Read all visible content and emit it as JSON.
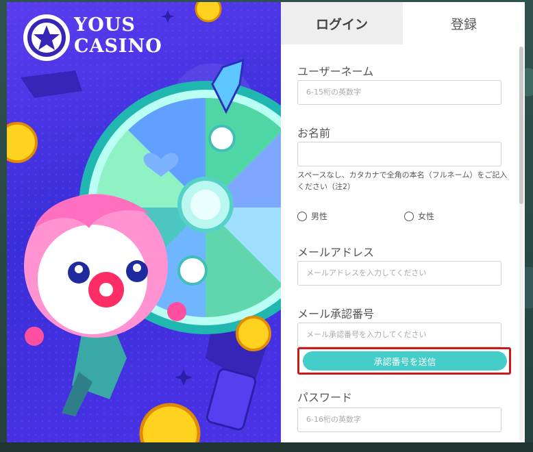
{
  "brand": {
    "logo_line1": "YOUS",
    "logo_line2": "CASINO"
  },
  "tabs": {
    "login": "ログイン",
    "register": "登録"
  },
  "form": {
    "username_label": "ユーザーネーム",
    "username_placeholder": "6-15桁の英数字",
    "name_label": "お名前",
    "name_value": "",
    "name_note": "スペースなし、カタカナで全角の本名（フルネーム）をご記入ください（注2）",
    "gender_male": "男性",
    "gender_female": "女性",
    "email_label": "メールアドレス",
    "email_placeholder": "メールアドレスを入力してください",
    "code_label": "メール承認番号",
    "code_placeholder": "メール承認番号を入力してください",
    "send_button": "承認番号を送信",
    "password_label": "パスワード",
    "password_placeholder": "6-16桁の英数字"
  },
  "colors": {
    "accent": "#45cec9",
    "highlight": "#c8191e",
    "promo_bg": "#4b33e6"
  }
}
